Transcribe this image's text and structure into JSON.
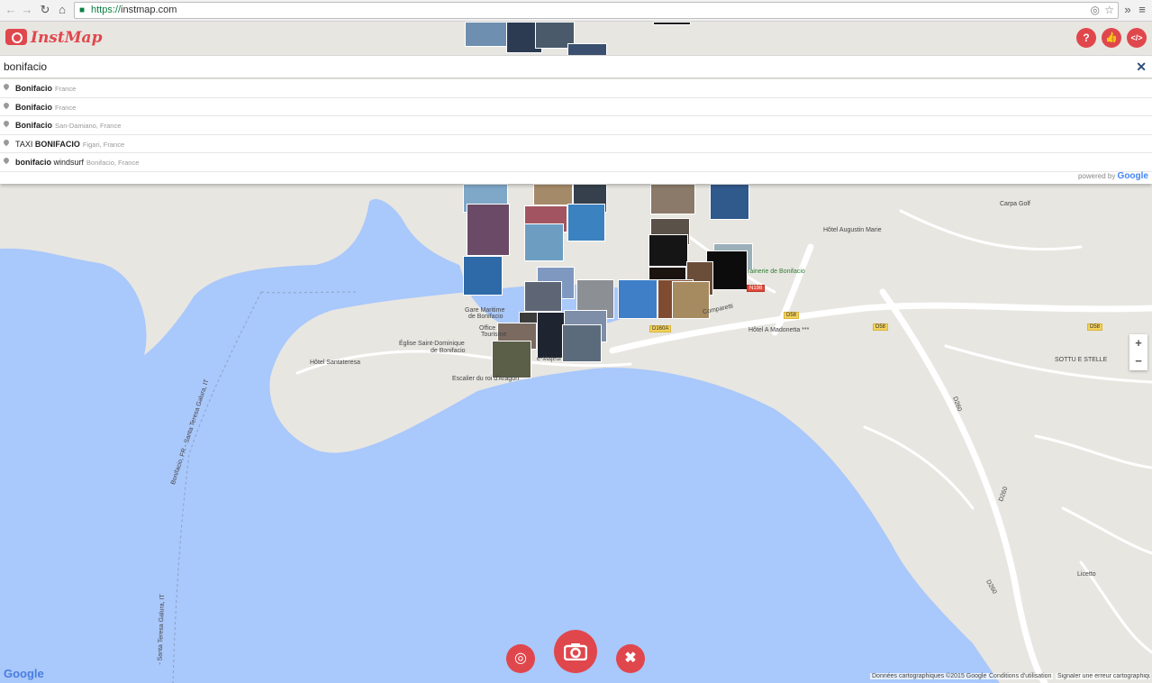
{
  "browser": {
    "url_scheme": "https://",
    "url_host": "instmap.com"
  },
  "app": {
    "logo_text": "InstMap",
    "help_label": "?",
    "code_label": "</>"
  },
  "search": {
    "value": "bonifacio",
    "clear_label": "✕"
  },
  "suggestions": [
    {
      "bold": "Bonifacio",
      "rest": "",
      "secondary": "France"
    },
    {
      "bold": "Bonifacio",
      "rest": "",
      "secondary": "France"
    },
    {
      "bold": "Bonifacio",
      "rest": "",
      "secondary": "San-Damiano, France"
    },
    {
      "prefix": "TAXI ",
      "bold": "BONIFACIO",
      "rest": "",
      "secondary": "Figari, France"
    },
    {
      "bold": "bonifacio",
      "rest": " windsurf",
      "secondary": "Bonifacio, France"
    }
  ],
  "powered_by": "powered by",
  "powered_google": "Google",
  "map_labels": {
    "carpa_golf": "Carpa Golf",
    "hotel_augustin": "Hôtel Augustin Marie",
    "brasserie": "rainerie de Bonifacio",
    "hotel_madonetta": "Hôtel A Madonetta ***",
    "sottu": "SOTTU E STELLE",
    "gare_maritime_1": "Gare Maritime",
    "gare_maritime_2": "de Bonifacio",
    "office_1": "Office",
    "office_2": "Tourisme",
    "eglise_1": "Église Saint-Dominique",
    "eglise_2": "de Bonifacio",
    "hotel_santateresa": "Hôtel Santateresa",
    "escalier": "Escalier du roi d'Aragon",
    "majeur": "e-Majeur",
    "comparetti": "Comparetti",
    "licetto": "Licetto",
    "ferry_1": "Bonifacio, FR - Santa Teresa Galura, IT",
    "ferry_2": "- Santa Teresa Galura, IT",
    "d58a": "D58",
    "d58b": "D58",
    "d160a": "D160A",
    "d260a": "D260",
    "d260b": "D260",
    "d260c": "D260",
    "n198": "N198"
  },
  "zoom": {
    "in": "+",
    "out": "−"
  },
  "attribution": {
    "data": "Données cartographiques ©2015 Google",
    "terms": "Conditions d'utilisation",
    "report": "Signaler une erreur cartographique"
  },
  "google_logo": "Google",
  "colors": {
    "accent": "#e0474c",
    "water": "#a9c8fb",
    "land": "#e8e6e1",
    "road": "#ffffff"
  }
}
